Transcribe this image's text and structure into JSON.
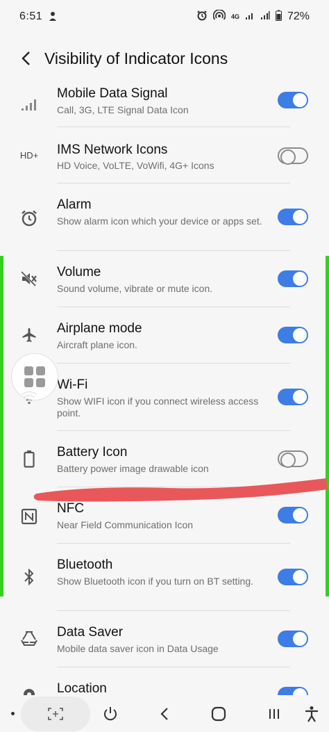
{
  "status_bar": {
    "time": "6:51",
    "battery": "72%",
    "net_label": "4G"
  },
  "header": {
    "title": "Visibility of Indicator Icons"
  },
  "items": [
    {
      "title": "Mobile Data Signal",
      "subtitle": "Call, 3G, LTE Signal Data Icon",
      "icon": "signal-icon",
      "enabled": true
    },
    {
      "title": "IMS Network Icons",
      "subtitle": "HD Voice, VoLTE, VoWifi, 4G+ Icons",
      "icon": "hd-plus-icon",
      "icon_text": "HD+",
      "enabled": false
    },
    {
      "title": "Alarm",
      "subtitle": "Show alarm icon which your device or apps set.",
      "icon": "alarm-icon",
      "enabled": true
    },
    {
      "title": "Volume",
      "subtitle": "Sound volume, vibrate or mute icon.",
      "icon": "volume-mute-icon",
      "enabled": true
    },
    {
      "title": "Airplane mode",
      "subtitle": "Aircraft plane icon.",
      "icon": "airplane-icon",
      "enabled": true
    },
    {
      "title": "Wi-Fi",
      "subtitle": "Show WIFI icon if you connect wireless access point.",
      "icon": "wifi-icon",
      "enabled": true
    },
    {
      "title": "Battery Icon",
      "subtitle": "Battery power image drawable icon",
      "icon": "battery-icon",
      "enabled": false
    },
    {
      "title": "NFC",
      "subtitle": "Near Field Communication Icon",
      "icon": "nfc-icon",
      "enabled": true
    },
    {
      "title": "Bluetooth",
      "subtitle": "Show Bluetooth icon if you turn on BT setting.",
      "icon": "bluetooth-icon",
      "enabled": true
    },
    {
      "title": "Data Saver",
      "subtitle": "Mobile data saver icon in Data Usage",
      "icon": "data-saver-icon",
      "enabled": true
    },
    {
      "title": "Location",
      "subtitle": "",
      "icon": "location-icon",
      "enabled": true
    }
  ],
  "colors": {
    "accent": "#3e7ce6",
    "edge_green": "#33d11d",
    "scribble_red": "#e8585a"
  }
}
